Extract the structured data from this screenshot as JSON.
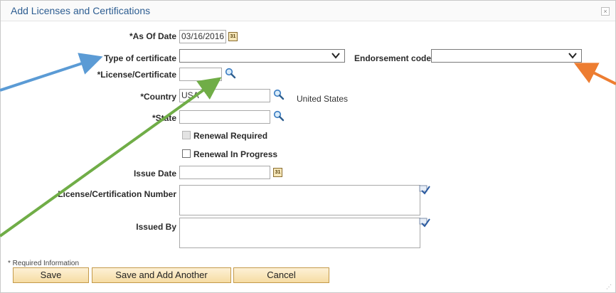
{
  "dialog": {
    "title": "Add Licenses and Certifications",
    "close_symbol": "×"
  },
  "form": {
    "as_of_date": {
      "label": "As Of Date",
      "required": "*",
      "value": "03/16/2016",
      "icon": "calendar-icon"
    },
    "type_of_certificate": {
      "label": "Type of certificate",
      "value": ""
    },
    "endorsement_code": {
      "label": "Endorsement code",
      "value": ""
    },
    "license_certificate": {
      "label": "License/Certificate",
      "required": "*",
      "value": "",
      "icon": "search-icon"
    },
    "country": {
      "label": "Country",
      "required": "*",
      "value": "USA",
      "description": "United States",
      "icon": "search-icon"
    },
    "state": {
      "label": "State",
      "required": "*",
      "value": "",
      "icon": "search-icon"
    },
    "renewal_required": {
      "label": "Renewal Required",
      "checked": false,
      "disabled": true
    },
    "renewal_in_progress": {
      "label": "Renewal In Progress",
      "checked": false
    },
    "issue_date": {
      "label": "Issue Date",
      "value": "",
      "icon": "calendar-icon"
    },
    "license_certification_number": {
      "label": "License/Certification Number",
      "value": "",
      "icon": "spell-check-icon"
    },
    "issued_by": {
      "label": "Issued By",
      "value": "",
      "icon": "spell-check-icon"
    }
  },
  "footer": {
    "required_info": "* Required Information",
    "save_label": "Save",
    "save_add_label": "Save and Add Another",
    "cancel_label": "Cancel"
  },
  "annotations": {
    "arrow_colors": {
      "blue": "#5b9bd5",
      "green": "#70ad47",
      "orange": "#ed7d31"
    }
  },
  "calendar_glyph": "31"
}
